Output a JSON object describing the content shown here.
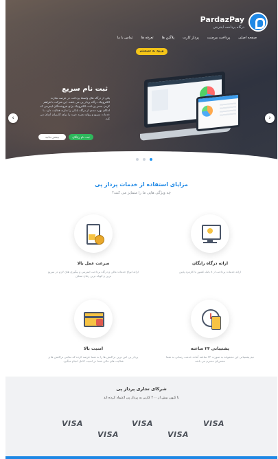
{
  "brand": {
    "name": "PardazPay",
    "tagline": "درگاه پرداخت اینترنتی"
  },
  "nav": {
    "items": [
      "صفحه اصلی",
      "پرداخت مرچنت",
      "پرداز کارت",
      "پلاگین ها",
      "تعرفه ها",
      "تماس با ما"
    ],
    "cta": "ورود به سیستم"
  },
  "hero": {
    "title": "ثبت نام سریع",
    "description": "یکی از درگاه های واسط پرداخت در عرصه تجارت الکترونیک درگاه پرداز پی می باشد. این شرکت با فراهم کردن بستر پرداخت الکترونیک برای فروشندگان اینترنتی که امکان بهره مندی از درگاه بانکی را ندارند فعالیت دارد. با خدمات سریع و روان تجربه خرید را برای کاربران آسان می کند.",
    "primary_button": "ثبت نام رایگان",
    "secondary_button": "بیشتر بدانید"
  },
  "benefits": {
    "title": "مزایای استفاده از خدمات پرداز پی",
    "subtitle": "چه ویژگی هایی ما را متمایز می کنند؟",
    "features": [
      {
        "title": "ارائه درگاه رایگان",
        "desc": "ارائه خدمات پرداخت از ۸ بانک کشور با کارمزد پایین",
        "icon": "gateway-icon"
      },
      {
        "title": "سرعت عمل بالا",
        "desc": "ارائه انواع خدمات مالی و درگاه پرداخت اینترنتی و پیگیری های لازم در سریع ترین و کوتاه ترین زمان ممکن",
        "icon": "hourglass-icon"
      },
      {
        "title": "پشتیبانی ۲۴ ساعته",
        "desc": "تیم پشتیبانی این مجموعه به صورت ۲۴ ساعته آماده خدمت رسانی به شما مشتریان محترم می باشد",
        "icon": "support-icon"
      },
      {
        "title": "امنیت بالا",
        "desc": "پرداز پی امن ترین تراکنش ها را به شما عرضه کرده که تمامی تراکنش ها و فعالیت های مالی شما در امنیت کامل انجام میگیرد",
        "icon": "secure-card-icon"
      }
    ]
  },
  "partners": {
    "title": "شرکای تجاری پرداز پی",
    "subtitle": "تا کنون بیش از ۲۰۰ کاربر به پرداز پی اعتماد کرده اند",
    "logos": [
      "VISA",
      "VISA",
      "VISA",
      "VISA",
      "VISA"
    ]
  },
  "colors": {
    "accent": "#1e88e5",
    "cta": "#f5c518",
    "green": "#2eb85c"
  }
}
